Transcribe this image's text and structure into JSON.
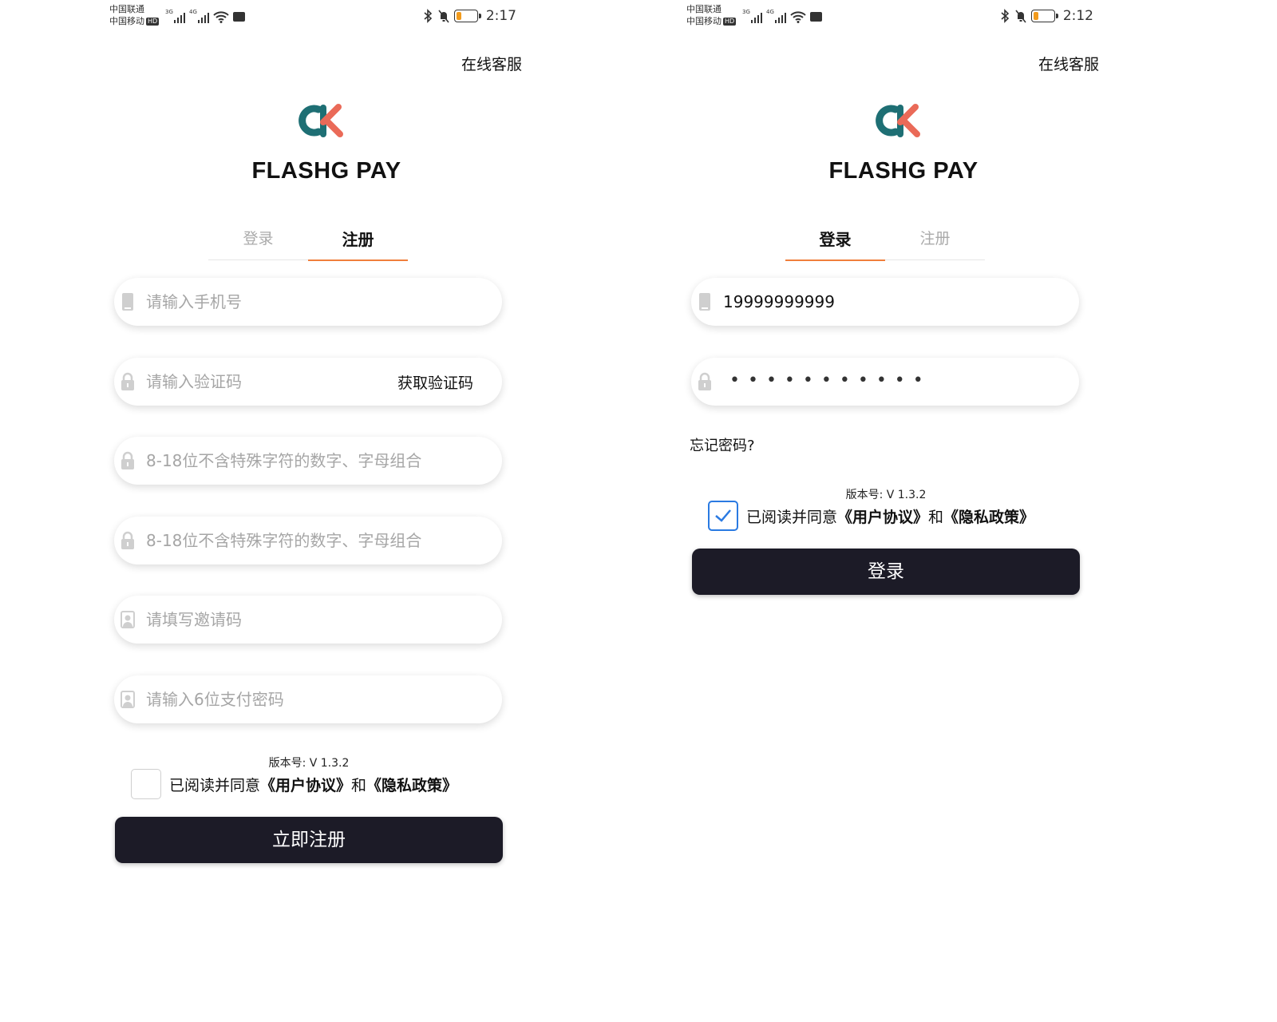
{
  "status_left": {
    "carrier1": "中国联通",
    "carrier2": "中国移动",
    "hd": "HD",
    "net1": "3G",
    "net2": "4G"
  },
  "brand": {
    "name": "FLASHG PAY",
    "logo_colors": {
      "teal": "#1e6f74",
      "coral": "#ea6a58"
    }
  },
  "theme": {
    "accent": "#f07f3c",
    "button_bg": "#1c1b27",
    "checkbox_blue": "#2a7ae2",
    "battery": "#f29b1d"
  },
  "register": {
    "time": "2:17",
    "service": "在线客服",
    "tabs": [
      {
        "label": "登录",
        "active": false
      },
      {
        "label": "注册",
        "active": true
      }
    ],
    "phone_placeholder": "请输入手机号",
    "code_placeholder": "请输入验证码",
    "get_code": "获取验证码",
    "password_placeholder": "8-18位不含特殊字符的数字、字母组合",
    "confirm_placeholder": "8-18位不含特殊字符的数字、字母组合",
    "invite_placeholder": "请填写邀请码",
    "paypwd_placeholder": "请输入6位支付密码",
    "version": "版本号:  V 1.3.2",
    "agree_prefix": "已阅读并同意",
    "user_agreement": "《用户协议》",
    "and": "和",
    "privacy_policy": "《隐私政策》",
    "agreed": false,
    "submit": "立即注册"
  },
  "login": {
    "time": "2:12",
    "service": "在线客服",
    "tabs": [
      {
        "label": "登录",
        "active": true
      },
      {
        "label": "注册",
        "active": false
      }
    ],
    "phone_value": "19999999999",
    "password_mask": "•••••••••••",
    "forgot": "忘记密码?",
    "version": "版本号:  V 1.3.2",
    "agree_prefix": "已阅读并同意",
    "user_agreement": "《用户协议》",
    "and": "和",
    "privacy_policy": "《隐私政策》",
    "agreed": true,
    "submit": "登录"
  }
}
